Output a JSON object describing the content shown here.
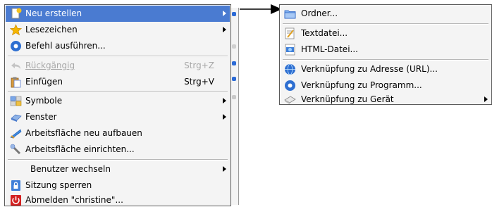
{
  "main_menu": {
    "items": [
      {
        "label": "Neu erstellen",
        "icon": "new-document-icon",
        "submenu": true,
        "active": true
      },
      {
        "label": "Lesezeichen",
        "icon": "star-icon",
        "submenu": true
      },
      {
        "label": "Befehl ausführen...",
        "icon": "run-command-icon"
      },
      {
        "label": "Rückgängig",
        "icon": "undo-icon",
        "shortcut": "Strg+Z",
        "disabled": true
      },
      {
        "label": "Einfügen",
        "icon": "paste-icon",
        "shortcut": "Strg+V"
      },
      {
        "label": "Symbole",
        "icon": "icons-icon",
        "submenu": true
      },
      {
        "label": "Fenster",
        "icon": "window-icon",
        "submenu": true
      },
      {
        "label": "Arbeitsfläche neu aufbauen",
        "icon": "refresh-desktop-icon"
      },
      {
        "label": "Arbeitsfläche einrichten...",
        "icon": "configure-desktop-icon"
      },
      {
        "label": "Benutzer wechseln",
        "submenu": true
      },
      {
        "label": "Sitzung sperren",
        "icon": "lock-icon"
      },
      {
        "label": "Abmelden \"christine\"...",
        "icon": "logout-icon"
      }
    ]
  },
  "sub_menu": {
    "items": [
      {
        "label": "Ordner...",
        "icon": "folder-icon"
      },
      {
        "label": "Textdatei...",
        "icon": "text-file-icon"
      },
      {
        "label": "HTML-Datei...",
        "icon": "html-file-icon"
      },
      {
        "label": "Verknüpfung zu Adresse (URL)...",
        "icon": "globe-link-icon"
      },
      {
        "label": "Verknüpfung zu Programm...",
        "icon": "program-link-icon"
      },
      {
        "label": "Verknüpfung zu Gerät",
        "icon": "device-link-icon",
        "submenu": true
      }
    ]
  },
  "colors": {
    "highlight": "#4a7bd1",
    "menu_bg": "#f4f4f4",
    "disabled_text": "#a8a8a8"
  }
}
